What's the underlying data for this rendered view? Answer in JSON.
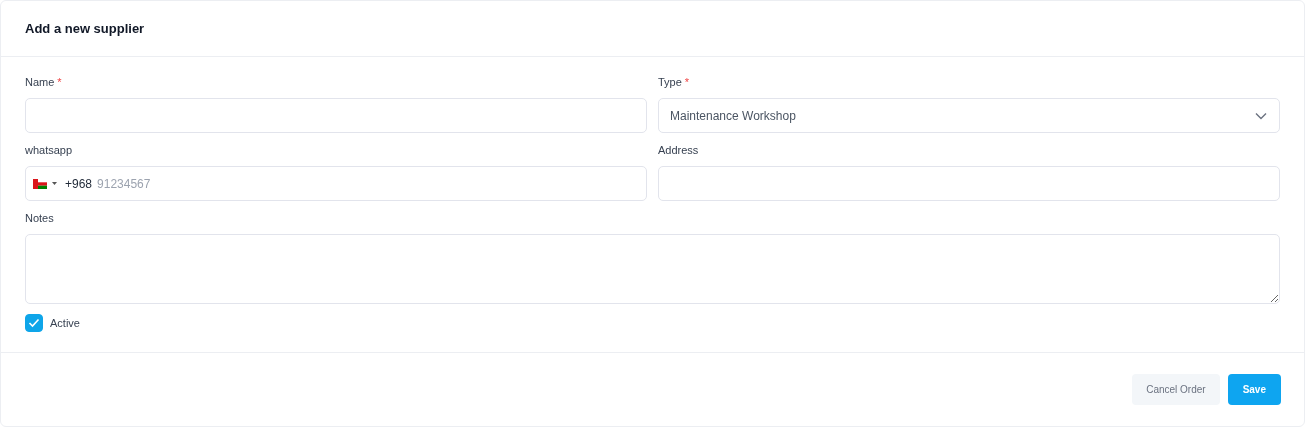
{
  "title": "Add a new supplier",
  "fields": [
    {
      "kind": "text",
      "label": "Name",
      "required": true
    },
    {
      "kind": "select",
      "label": "Type",
      "required": true,
      "value": "Maintenance Workshop"
    },
    {
      "kind": "phone",
      "label": "whatsapp",
      "required": false,
      "dial_code": "+968",
      "placeholder": "91234567"
    },
    {
      "kind": "text",
      "label": "Address",
      "required": false
    },
    {
      "kind": "textarea",
      "label": "Notes",
      "required": false
    }
  ],
  "required_mark": "*",
  "active": {
    "label": "Active",
    "checked": true
  },
  "buttons": [
    {
      "kind": "secondary",
      "label": "Cancel Order"
    },
    {
      "kind": "primary",
      "label": "Save"
    }
  ]
}
